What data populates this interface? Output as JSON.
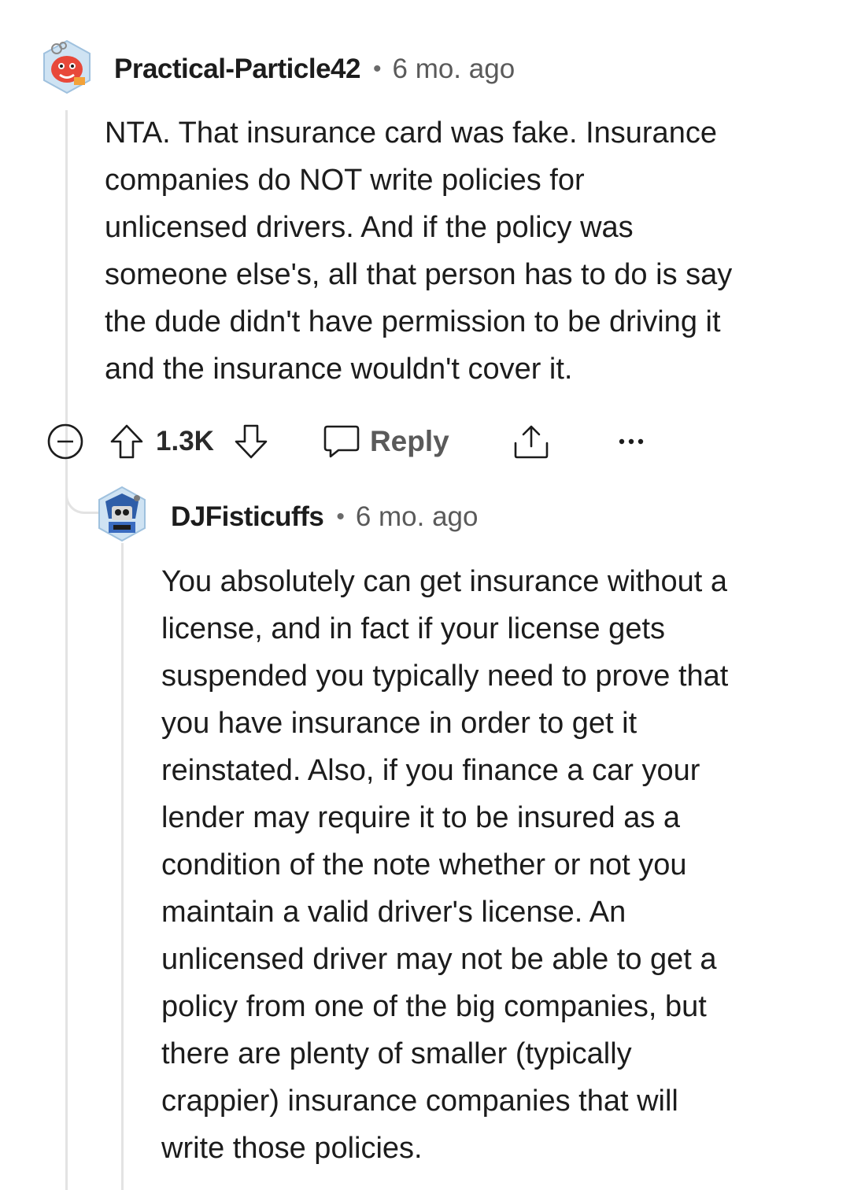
{
  "comments": [
    {
      "username": "Practical-Particle42",
      "timestamp": "6 mo. ago",
      "body_lines": [
        "NTA. That insurance card was fake. Insurance",
        "companies do NOT write policies for",
        "unlicensed drivers. And if the policy was",
        "someone else's, all that person has to do is say",
        "the dude didn't have permission to be driving it",
        "and the insurance wouldn't cover it."
      ],
      "score": "1.3K",
      "reply_label": "Reply",
      "avatar_icon": "snoo-avatar-red-icon"
    },
    {
      "username": "DJFisticuffs",
      "timestamp": "6 mo. ago",
      "body_lines": [
        "You absolutely can get insurance without a",
        "license, and in fact if your license gets",
        "suspended you typically need to prove that",
        "you have insurance in order to get it",
        "reinstated. Also, if you finance a car your",
        "lender may require it to be insured as a",
        "condition of the note whether or not you",
        "maintain a valid driver's license. An",
        "unlicensed driver may not be able to get a",
        "policy from one of the big companies, but",
        "there are plenty of smaller (typically",
        "crappier) insurance companies that will",
        "write those policies."
      ],
      "avatar_icon": "snoo-avatar-robot-icon"
    }
  ],
  "separator": "•",
  "colors": {
    "text": "#1c1c1c",
    "muted": "#5a5a5a",
    "thread_line": "#e3e3e3"
  }
}
